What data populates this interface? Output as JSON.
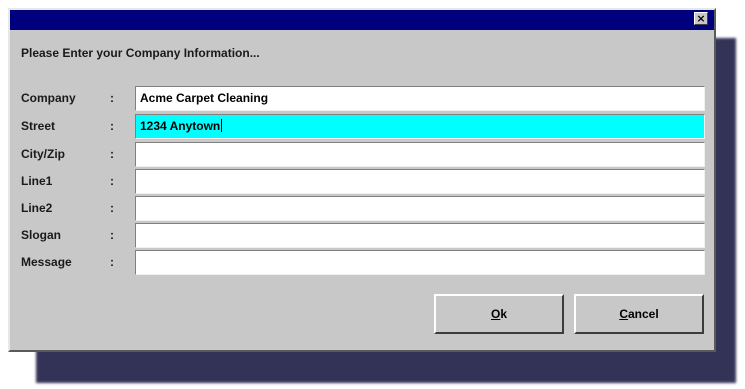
{
  "window": {
    "close_glyph": "×",
    "title_color": "#00007e"
  },
  "dialog": {
    "prompt": "Please Enter your Company Information..."
  },
  "fields": [
    {
      "label": "Company",
      "separator": ":",
      "value": "Acme Carpet Cleaning",
      "active": false
    },
    {
      "label": "Street",
      "separator": ":",
      "value": "1234 Anytown",
      "active": true
    },
    {
      "label": "City/Zip",
      "separator": ":",
      "value": "",
      "active": false
    },
    {
      "label": "Line1",
      "separator": ":",
      "value": "",
      "active": false
    },
    {
      "label": "Line2",
      "separator": ":",
      "value": "",
      "active": false
    },
    {
      "label": "Slogan",
      "separator": ":",
      "value": "",
      "active": false
    },
    {
      "label": "Message",
      "separator": ":",
      "value": "",
      "active": false
    }
  ],
  "buttons": {
    "ok": {
      "mnemonic": "O",
      "rest": "k"
    },
    "cancel": {
      "mnemonic": "C",
      "rest": "ancel"
    }
  },
  "colors": {
    "active_field": "#00ffff",
    "dialog_face": "#c8c8c8",
    "shadow": "#22224a"
  },
  "icons": {
    "close": "close-icon"
  }
}
